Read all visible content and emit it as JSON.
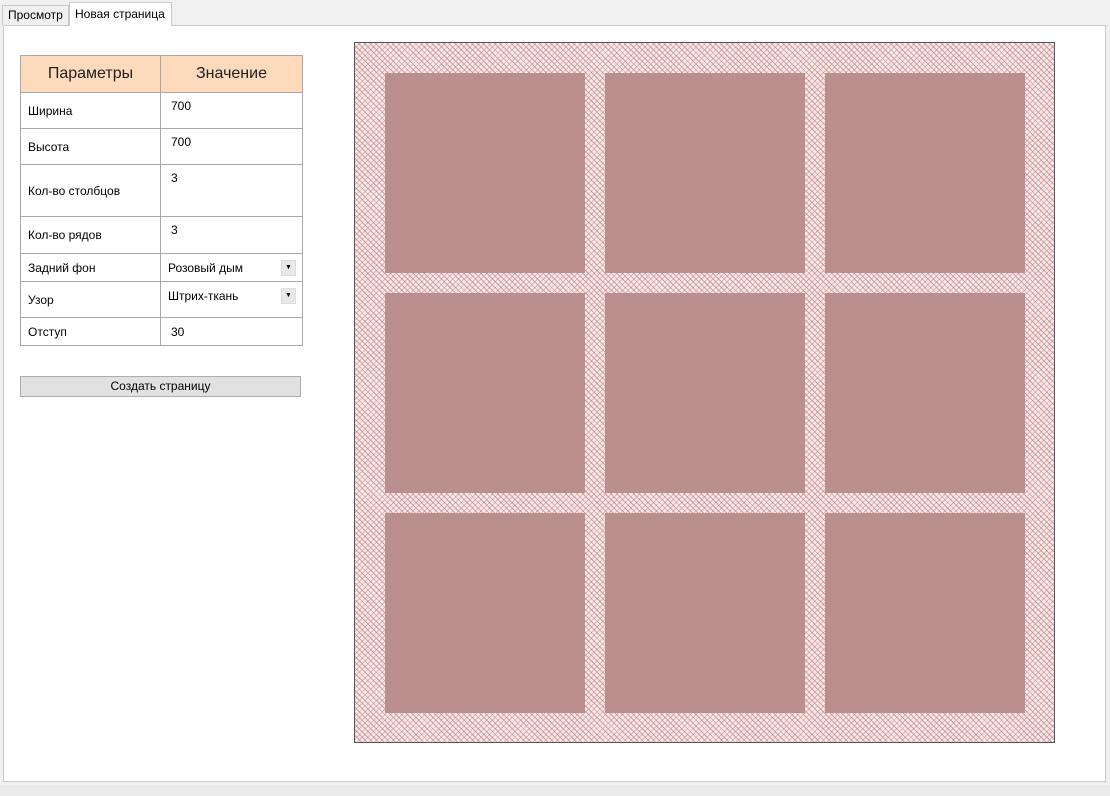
{
  "tabs": [
    {
      "label": "Просмотр",
      "active": false
    },
    {
      "label": "Новая страница",
      "active": true
    }
  ],
  "params_table": {
    "headers": {
      "param": "Параметры",
      "value": "Значение"
    },
    "rows": [
      {
        "label": "Ширина",
        "value": "700"
      },
      {
        "label": "Высота",
        "value": "700"
      },
      {
        "label": "Кол-во столбцов",
        "value": "3"
      },
      {
        "label": "Кол-во рядов",
        "value": "3"
      },
      {
        "label": "Задний фон",
        "value": "Розовый дым"
      },
      {
        "label": "Узор",
        "value": "Штрих-ткань"
      },
      {
        "label": "Отступ",
        "value": "30"
      }
    ]
  },
  "create_button_label": "Создать страницу",
  "preview": {
    "rows": 3,
    "columns": 3,
    "cell_color": "#bc8f8f",
    "background_color": "#f6eaea",
    "pattern_color": "#c47878",
    "border_color": "#555555"
  },
  "icons": {
    "dropdown": "chevron-down-icon"
  }
}
